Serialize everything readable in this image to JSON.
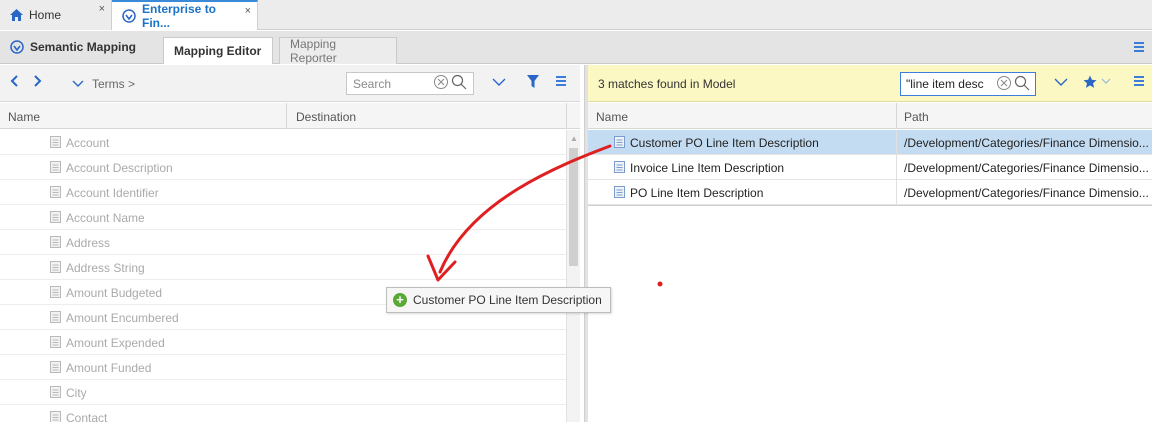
{
  "colors": {
    "accent": "#3b7dd8",
    "highlight_bar": "#fbf8c3",
    "selected_row": "#c4dcf2",
    "annotation": "#e02020"
  },
  "doc_tabs": [
    {
      "label": "Home",
      "icon": "home-icon",
      "close": "×"
    },
    {
      "label": "Enterprise to Fin...",
      "icon": "mapping-icon",
      "close": "×"
    }
  ],
  "subbar": {
    "section_label": "Semantic Mapping",
    "tabs": [
      {
        "label": "Mapping Editor"
      },
      {
        "label": "Mapping Reporter"
      }
    ]
  },
  "left": {
    "breadcrumb": "Terms >",
    "search_placeholder": "Search",
    "columns": [
      "Name",
      "Destination"
    ],
    "rows": [
      "Account",
      "Account Description",
      "Account Identifier",
      "Account Name",
      "Address",
      "Address String",
      "Amount Budgeted",
      "Amount Encumbered",
      "Amount Expended",
      "Amount Funded",
      "City",
      "Contact"
    ]
  },
  "right": {
    "status": "3 matches found in Model",
    "search_value": "\"line item desc",
    "columns": [
      "Name",
      "Path"
    ],
    "rows": [
      {
        "name": "Customer PO Line Item Description",
        "path": "/Development/Categories/Finance Dimensio...",
        "selected": true
      },
      {
        "name": "Invoice Line Item Description",
        "path": "/Development/Categories/Finance Dimensio...",
        "selected": false
      },
      {
        "name": "PO Line Item Description",
        "path": "/Development/Categories/Finance Dimensio...",
        "selected": false
      }
    ]
  },
  "drag_tooltip": "Customer PO Line Item Description"
}
